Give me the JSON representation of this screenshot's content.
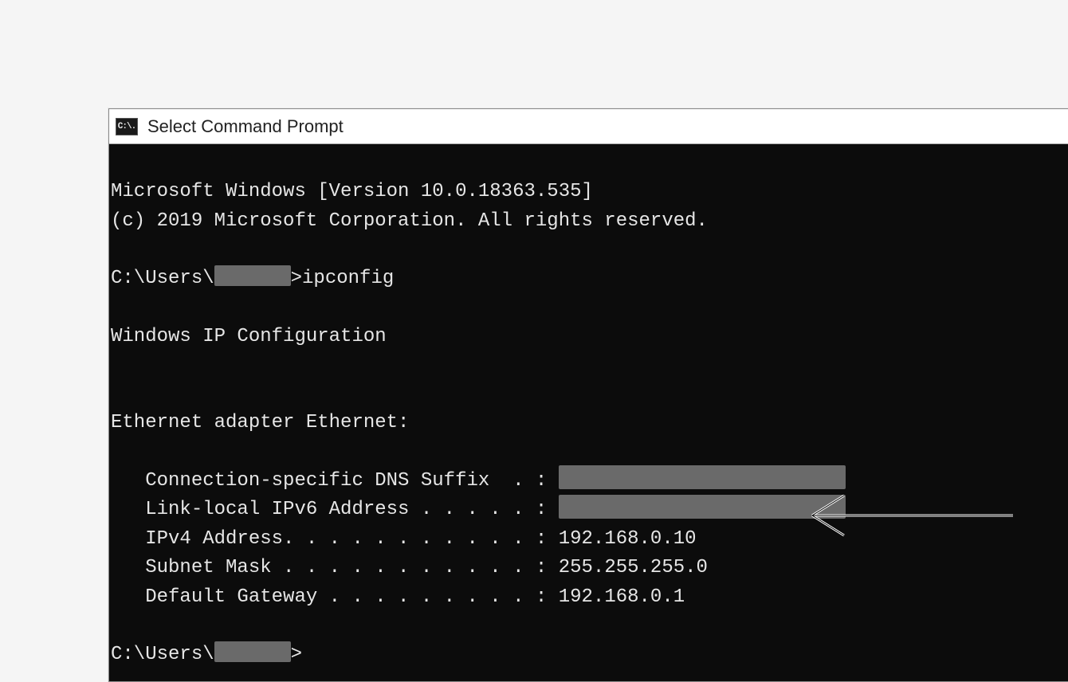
{
  "titlebar": {
    "icon_text": "C:\\.",
    "title": "Select Command Prompt"
  },
  "terminal": {
    "line1": "Microsoft Windows [Version 10.0.18363.535]",
    "line2": "(c) 2019 Microsoft Corporation. All rights reserved.",
    "blank": "",
    "prompt_prefix": "C:\\Users\\",
    "prompt_suffix": ">",
    "command": "ipconfig",
    "ipcfg_header": "Windows IP Configuration",
    "adapter_header": "Ethernet adapter Ethernet:",
    "dns_label": "   Connection-specific DNS Suffix  . : ",
    "ipv6_label": "   Link-local IPv6 Address . . . . . : ",
    "ipv4_label": "   IPv4 Address. . . . . . . . . . . : ",
    "ipv4_value": "192.168.0.10",
    "mask_label": "   Subnet Mask . . . . . . . . . . . : ",
    "mask_value": "255.255.255.0",
    "gw_label": "   Default Gateway . . . . . . . . . : ",
    "gw_value": "192.168.0.1"
  }
}
